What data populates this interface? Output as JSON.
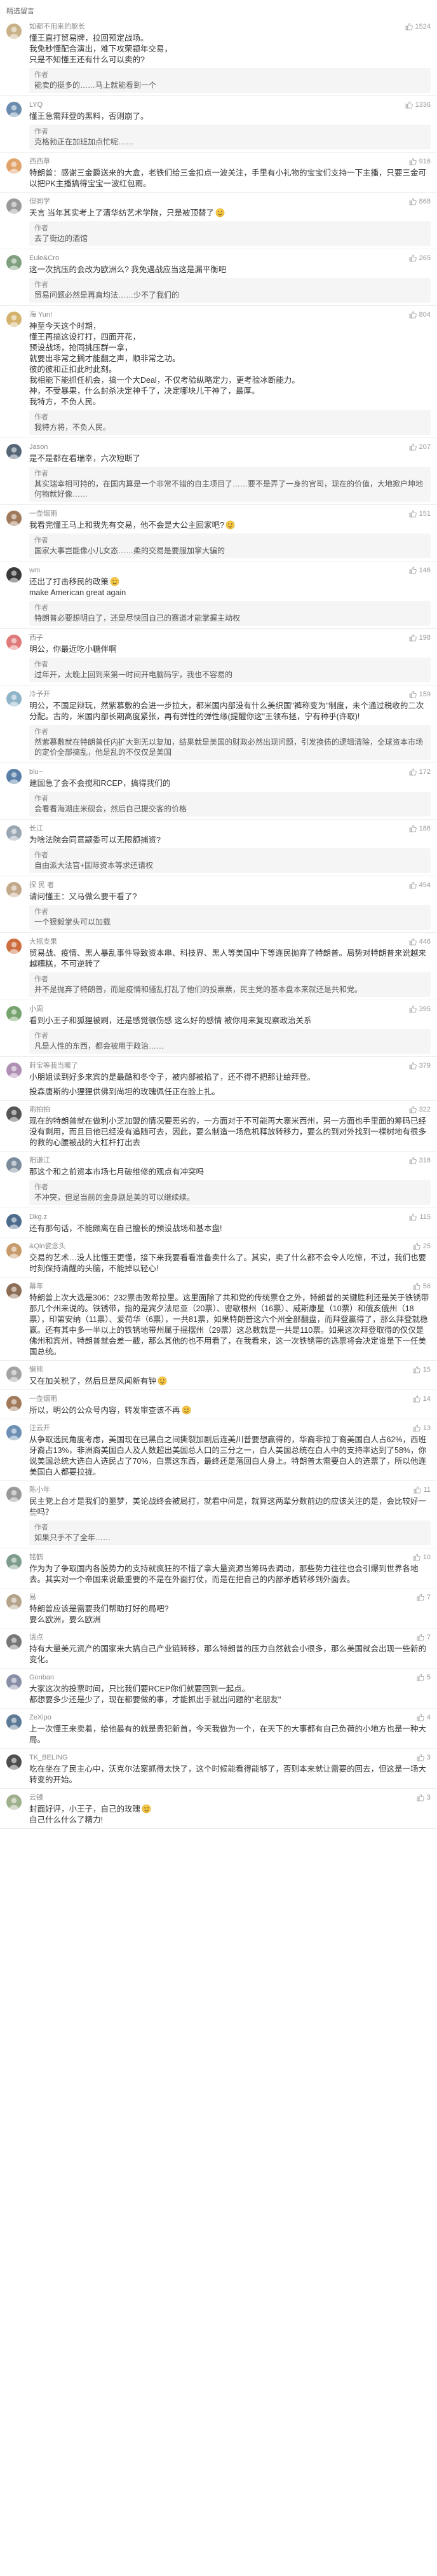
{
  "section_title": "精选留言",
  "colors": {
    "like_icon": "#b0b0b0",
    "username": "#8a8a8a",
    "text": "#333333",
    "reply_bg": "#f5f5f5"
  },
  "comments": [
    {
      "user": "如都不用来的躯长",
      "likes": "1524",
      "body": "懂王直打贸易牌，拉回预定战场。\n我免秒懂配合演出，难下攻荣颛年交易，\n只是不知懂王还有什么可以卖的?",
      "reply_author": "作者",
      "reply_text": "能卖的挺多的……马上就能看到一个",
      "avatar": "#c9b28a"
    },
    {
      "user": "LYQ",
      "likes": "1336",
      "body": "懂王急需拜登的黑料，否则崩了。",
      "reply_author": "作者",
      "reply_text": "克格勃正在加班加点忙呢……",
      "avatar": "#6b8cae"
    },
    {
      "user": "西西草",
      "likes": "916",
      "body": "特朗普：感谢三金爵送来的大盒，老铁们给三金扣点一波关注，手里有小礼物的宝宝们支持一下主播，只要三金可以把PK主播搞得宝宝一波红包雨。",
      "reply_author": "",
      "reply_text": "",
      "avatar": "#e2a36b"
    },
    {
      "user": "但同学",
      "likes": "868",
      "body": "天言 当年其实考上了清华纺艺术学院，只是被顶替了",
      "emoji": true,
      "reply_author": "作者",
      "reply_text": "去了街边的酒馆",
      "avatar": "#9a9a9a"
    },
    {
      "user": "Eule&Cro",
      "likes": "265",
      "body": "这一次抗压的会改为欧洲么? 我免遇战应当这是漏平衡吧",
      "reply_author": "作者",
      "reply_text": "贸易问题必然是再直均法……少不了我们的",
      "avatar": "#7f9f7f"
    },
    {
      "user": "海 Yun!",
      "likes": "804",
      "body": "神至今天这个时期，\n懂王再搞这设打打，四面开花，\n预设战场，抢同挑压群一拿，\n就要出非常之搁才能翻之声，顺非常之功。\n彼的彼和正扣此时此刻。\n我相能下能抓任机会，搞一个大Deal，不仅考验纵略定力，更考验冰断能力。\n神，不受暴果，什么封杀决定神千了，决定哪块儿干神了，最厚。\n我特方，不负人民。",
      "reply_author": "作者",
      "reply_text": "我特方将，不负人民。",
      "avatar": "#d4b36f"
    },
    {
      "user": "Jason",
      "likes": "207",
      "body": "是不是都在看瑞幸，六次短断了",
      "reply_author": "作者",
      "reply_text": "其实瑞幸相可持的，在国内算是一个非常不错的自主项目了……要不是弄了一身的官司，现在的价值，大地掀户坤地何物就好像……",
      "avatar": "#556677"
    },
    {
      "user": "一壶烟雨",
      "likes": "151",
      "body": "我看完懂王马上和我先有交易，他不会是大公主回家吧?",
      "emoji": true,
      "reply_author": "作者",
      "reply_text": "国家大事岂能像小儿女态……柔的交易是要服加掌大骗的",
      "avatar": "#a07a5a"
    },
    {
      "user": "wm",
      "likes": "146",
      "body": "还出了打击移民的政策",
      "emoji": true,
      "body2": "make American great again",
      "reply_author": "作者",
      "reply_text": "特朗普必要想明白了，还是尽快回自己的赛道才能掌握主动权",
      "avatar": "#3a3a3a"
    },
    {
      "user": "西子",
      "likes": "198",
      "body": "明公，你最近吃小糖伴啊",
      "reply_author": "作者",
      "reply_text": "过年开，太晚上回到来第一时间开电脑码字，我也不容易的",
      "avatar": "#e07a7a"
    },
    {
      "user": "冷予开",
      "likes": "159",
      "body": "明公，不国足辩玩，然紫慕敷的会进一步拉大，都米国内部没有什么美织国\"裤称变为\"制度，未个通过税收的二次分配。古的，米国内部长期高度紧张，再有弹性的弹性缘(提醒你这\"王领布拯，宁有种乎(许取)!",
      "reply_author": "作者",
      "reply_text": "然紫慕敷就在特朗普任内扩大到无以复加，结果就是美国的财政必然出现问题，引发换债的逻辑清除，全球资本市场的定价全部搞乱，他是乱的不仅仅是美国",
      "avatar": "#8fb3c9"
    },
    {
      "user": "blu~",
      "likes": "172",
      "body": "建国急了会不会搅和RCEP，搞得我们的",
      "reply_author": "作者",
      "reply_text": "会看看海湖庄米砚会，然后自己提交客的价格",
      "avatar": "#5a7fa8"
    },
    {
      "user": "长江",
      "likes": "186",
      "body": "为啥法院会同意颛委可以无限额捕资?",
      "reply_author": "作者",
      "reply_text": "自由派大法官+国际资本等求还请权",
      "avatar": "#9aa7b3"
    },
    {
      "user": "探 民 者",
      "likes": "454",
      "body": "请问懂王：又马做么要干看了?",
      "reply_author": "作者",
      "reply_text": "一个狠毅掌头可以加载",
      "avatar": "#c2a98c"
    },
    {
      "user": "大摇支果",
      "likes": "446",
      "body": "贸易战、疫情、黑人暴乱事件导致资本串、科技界、黑人等美国中下等连民抛弃了特朗普。局势对特朗普来说越来越糟糕，不可逆转了",
      "reply_author": "作者",
      "reply_text": "并不是抛弃了特朗普，而是疫情和骚乱打乱了他们的投票票，民主党的基本盘本来就还是共和党。",
      "avatar": "#cc6e3f"
    },
    {
      "user": "小周",
      "likes": "395",
      "body": "看到小王子和狐狸被刷，还是感觉很伤感 这么好的感情 被你用来复现察政治关系",
      "reply_author": "作者",
      "reply_text": "凡是人性的东西，都会被用于政治……",
      "avatar": "#77a36e"
    },
    {
      "user": "莳宝等我当暖了",
      "likes": "379",
      "body": "小朋姐读到好多来宾的是最酷和冬令子，被内部被掐了，还不得不把那让给拜登。",
      "reply_author": "",
      "reply_text": "",
      "body_more": "投森唐斯的小狸狸供佛到尚坦的玫瑰佩任正在脸上扎。",
      "avatar": "#b08fb5"
    },
    {
      "user": "雨拍拍",
      "likes": "322",
      "body": "现在的特朗普就在做利小芝加盟的情况要恶劣的，一方面对于不可能再大寨米西州，另一方面也手里面的筹码已经没有剩用，而且目他已经没有追随可去，因此，要么制造一场危机释放转移力，要么的到对外找到一棵树地有很多的救的心腰被战的大杠杆打出去",
      "reply_author": "",
      "reply_text": "",
      "avatar": "#555555"
    },
    {
      "user": "阳谦江",
      "likes": "318",
      "body": "那这个和之前资本市场七月破维修的观点有冲突吗",
      "reply_author": "作者",
      "reply_text": "不冲突，但是当前的金身剧是美的可以继续续。",
      "avatar": "#7a8b9c"
    },
    {
      "user": "Dkg.z",
      "likes": "115",
      "body": "还有那句话，不能颇离在自己擅长的预设战场和基本盘!",
      "reply_author": "",
      "reply_text": "",
      "avatar": "#4d6b8c"
    },
    {
      "user": "&Qin瓷念头",
      "likes": "25",
      "body": "交易的艺术…没人比懂王更懂，接下来我要看看准备卖什么了。其实，卖了什么都不会令人吃惊，不过，我们也要时刻保持清醒的头脑，不能掉以轻心!",
      "reply_author": "",
      "reply_text": "",
      "avatar": "#c79b6a"
    },
    {
      "user": "幕年",
      "likes": "56",
      "body": "特朗普上次大选是306：232票击败希拉里。这里面除了共和党的传统票仓之外，特朗普的关键胜利还是关于铁锈带那几个州来说的。铁锈带，指的是宾夕法尼亚（20票）、密歇根州（16票）、威斯康星（10票）和俄亥俄州（18票），印第安纳（11票）、爱荷华（6票），一共81票，如果特朗普这六个州全部翻盘，而拜登赢得了，那么拜登就稳赢。还有其中多一半以上的铁锈地带州属于摇摆州（29票）这总数就是一共是110票。如果这次拜登取得的仅仅是佛州和宾州，特朗普就会差一截，那么其他的也不用看了，在我看来，这一次铁锈带的选票将会决定谁是下一任美国总统。",
      "reply_author": "",
      "reply_text": "",
      "avatar": "#8c6d55"
    },
    {
      "user": "懒熊",
      "likes": "15",
      "body": "又在加关税了，然后旦是风闻新有钟",
      "emoji": true,
      "reply_author": "",
      "reply_text": "",
      "avatar": "#a3a3a3"
    },
    {
      "user": "一壶烟雨",
      "likes": "14",
      "body": "所以，明公的公众号内容，转发审查该不再",
      "emoji": true,
      "reply_author": "",
      "reply_text": "",
      "avatar": "#a07a5a"
    },
    {
      "user": "汪云开",
      "likes": "13",
      "body": "从争取选民角度考虑，美国现在已黑白之间撕裂加剧后连美川普要想赢得的，华裔非拉丁裔美国白人占62%，西班牙裔占13%，非洲裔美国白人及人数超出美国总人口的三分之一，白人美国总统在白人中的支持率达到了58%，你说美国总统大选白人选民占了70%，白票这东西，最终还是落回白人身上。特朗普太需要白人的选票了，所以他连美国白人都要拉拢。",
      "reply_author": "",
      "reply_text": "",
      "avatar": "#6d8fb3"
    },
    {
      "user": "陈小年",
      "likes": "11",
      "body": "民主党上台才是我们的噩梦，美论战终会被局打，就看中间是，就算这两辈分数前边的应该关注的是，会比较好一些吗？",
      "reply_author": "作者",
      "reply_text": "如果只手不了全年……",
      "avatar": "#999999"
    },
    {
      "user": "铭鹤",
      "likes": "10",
      "body": "作为为了争取国内各股势力的支持就疯狂的不惜了拿大量资源当筹码去调动，那些势力往往也会引爆到世界各地去。其实对一个帝国来说最重要的不是在外面打仗，而是在把自己的内部矛盾转移到外面去。",
      "reply_author": "",
      "reply_text": "",
      "avatar": "#7d9c8b"
    },
    {
      "user": "易",
      "likes": "7",
      "body": "特朗普应该是需要我们帮助打好的局吧?\n要么欧洲，要么欧洲",
      "reply_author": "",
      "reply_text": "",
      "avatar": "#b5a38c"
    },
    {
      "user": "请点",
      "likes": "7",
      "body": "持有大量美元资产的国家来大搞自己产业链转移，那么特朗普的压力自然就会小很多，那么美国就会出现一些新的变化。",
      "reply_author": "",
      "reply_text": "",
      "avatar": "#777777"
    },
    {
      "user": "Gonban",
      "likes": "5",
      "body": "大家这次的投票时间，只比我们要RCEP你们就要回到一起点。\n都想要多少还是少了，现在都要做的事，才能抓出手就出问题的\"老朋友\"",
      "reply_author": "",
      "reply_text": "",
      "avatar": "#8a8fa8"
    },
    {
      "user": "ZeXipo",
      "likes": "4",
      "body": "上一次懂王来卖着，给他最有的就是贵犯新首，今天我做为一个，在天下的大事都有自己负荷的小地方也是一种大局。",
      "reply_author": "",
      "reply_text": "",
      "avatar": "#5d7a96"
    },
    {
      "user": "TK_BELING",
      "likes": "3",
      "body": "吃在坐在了民主心中，沃克尔法案抓得太快了，这个时候能看得能够了，否则本来就让需要的回去，但这是一场大转变的开始。",
      "reply_author": "",
      "reply_text": "",
      "avatar": "#4e4e4e"
    },
    {
      "user": "云镜",
      "likes": "3",
      "body": "封面好评，小王子，自己的玫瑰",
      "emoji": true,
      "body2": "自己什么什么了精力!",
      "reply_author": "",
      "reply_text": "",
      "avatar": "#9fb08d"
    }
  ]
}
